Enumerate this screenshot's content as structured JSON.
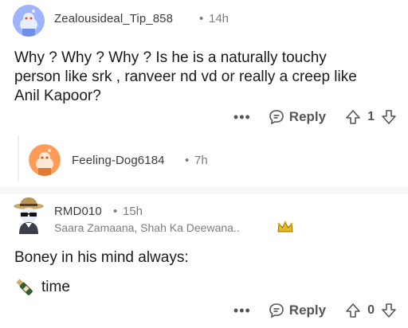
{
  "comments": [
    {
      "username": "Zealousideal_Tip_858",
      "separator": "•",
      "time": "14h",
      "body_lines": [
        "Why ? Why ? Why ? Is he is a naturally touchy",
        "person like srk , ranveer nd vd or really a creep like",
        "Anil Kapoor?"
      ],
      "more_label": "•••",
      "reply_label": "Reply",
      "score": "1"
    },
    {
      "username": "RMD010",
      "separator": "•",
      "time": "15h",
      "flair": "Saara Zamaana, Shah Ka Deewana..",
      "body_lines": [
        "Boney in his mind always:",
        "time"
      ],
      "more_label": "•••",
      "reply_label": "Reply",
      "score": "0"
    }
  ],
  "reply_preview": {
    "username": "Feeling-Dog6184",
    "separator": "•",
    "time": "7h"
  },
  "colors": {
    "avatar_blue": "#7193ff",
    "avatar_orange": "#ff8a3d",
    "divider": "#f6f7f8"
  },
  "icons": [
    "snoo-avatar-icon",
    "reply-bubble-icon",
    "upvote-arrow-icon",
    "downvote-arrow-icon",
    "crown-icon",
    "bottle-icon",
    "more-dots-icon"
  ]
}
